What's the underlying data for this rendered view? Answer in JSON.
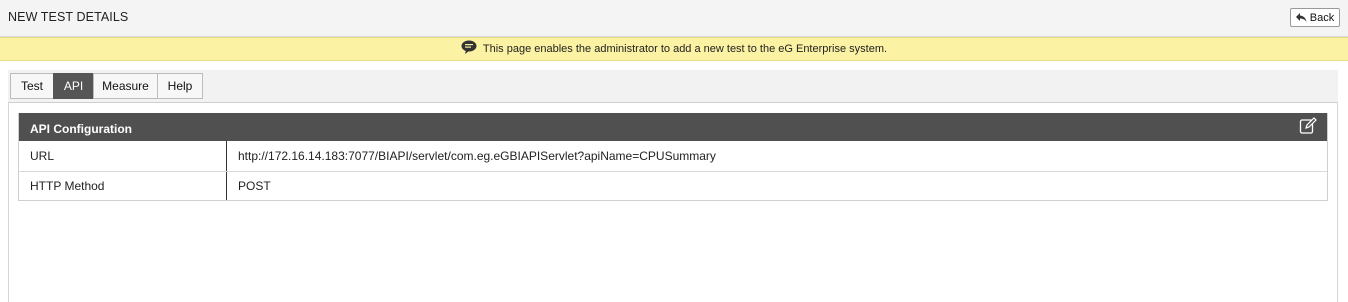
{
  "header": {
    "title": "NEW TEST DETAILS",
    "back_label": "Back"
  },
  "notice": {
    "icon": "speech-bubble-icon",
    "text": "This page enables the administrator to add a new test to the eG Enterprise system."
  },
  "tabs": [
    {
      "label": "Test",
      "active": false
    },
    {
      "label": "API",
      "active": true
    },
    {
      "label": "Measure",
      "active": false
    },
    {
      "label": "Help",
      "active": false
    }
  ],
  "panel": {
    "title": "API Configuration",
    "edit_icon": "edit-icon",
    "rows": [
      {
        "label": "URL",
        "value": "http://172.16.14.183:7077/BIAPI/servlet/com.eg.eGBIAPIServlet?apiName=CPUSummary"
      },
      {
        "label": "HTTP Method",
        "value": "POST"
      }
    ]
  },
  "colors": {
    "notice_bg": "#fbf2a3",
    "panel_header_bg": "#505050",
    "active_tab_bg": "#555555"
  }
}
